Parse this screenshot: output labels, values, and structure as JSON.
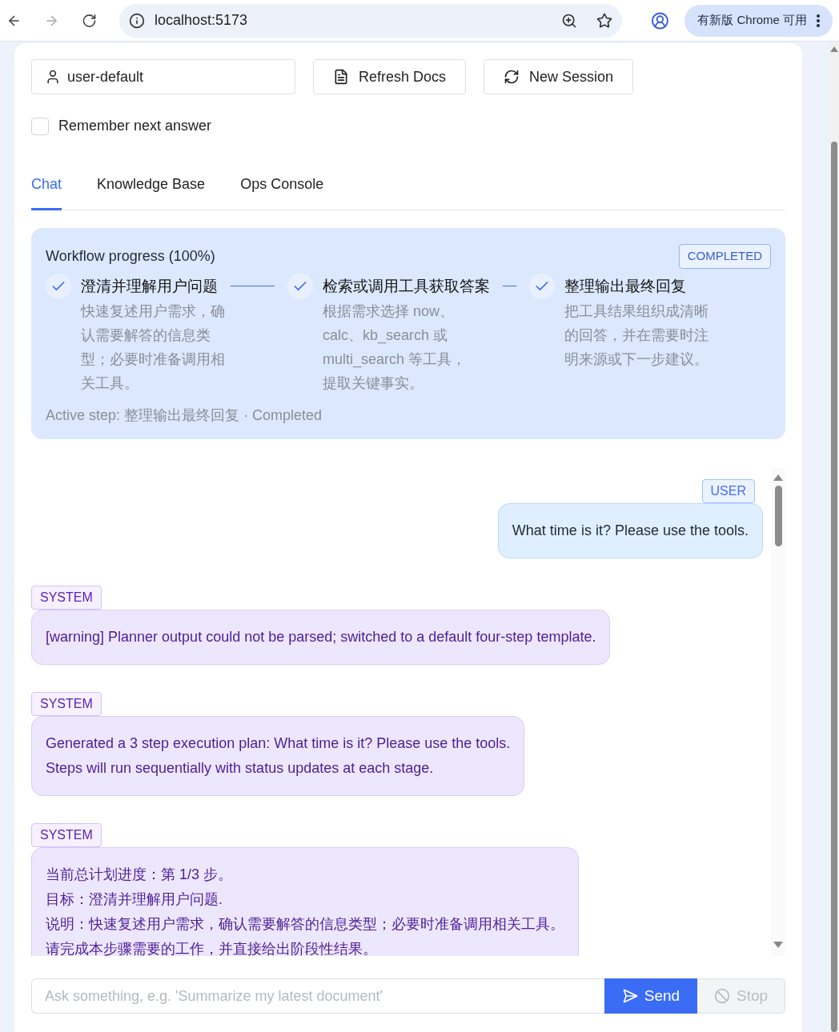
{
  "browser": {
    "url": "localhost:5173",
    "update_button": "有新版 Chrome 可用"
  },
  "toolbar": {
    "user_field": "user-default",
    "buttons": [
      "Refresh Docs",
      "New Session"
    ]
  },
  "remember": {
    "label": "Remember next answer",
    "checked": false
  },
  "tabs": [
    {
      "label": "Chat",
      "selected": true
    },
    {
      "label": "Knowledge Base",
      "selected": false
    },
    {
      "label": "Ops Console",
      "selected": false
    }
  ],
  "workflow": {
    "title": "Workflow progress (100%)",
    "status": "COMPLETED",
    "steps": [
      {
        "title": "澄清并理解用户问题",
        "description": "快速复述用户需求，确认需要解答的信息类型；必要时准备调用相关工具。",
        "done": true
      },
      {
        "title": "检索或调用工具获取答案",
        "description": "根据需求选择 now、calc、kb_search 或 multi_search 等工具，提取关键事实。",
        "done": true
      },
      {
        "title": "整理输出最终回复",
        "description": "把工具结果组织成清晰的回答，并在需要时注明来源或下一步建议。",
        "done": true
      }
    ],
    "active_step": "Active step: 整理输出最终回复 · Completed"
  },
  "messages": [
    {
      "kind": "user",
      "badge": "USER",
      "lines": [
        "What time is it? Please use the tools."
      ]
    },
    {
      "kind": "system",
      "badge": "SYSTEM",
      "lines": [
        "[warning] Planner output could not be parsed; switched to a default four-step template."
      ]
    },
    {
      "kind": "system",
      "badge": "SYSTEM",
      "lines": [
        "Generated a 3 step execution plan: What time is it? Please use the tools.",
        "Steps will run sequentially with status updates at each stage."
      ]
    },
    {
      "kind": "system",
      "badge": "SYSTEM",
      "lines": [
        "当前总计划进度：第 1/3 步。",
        "目标：澄清并理解用户问题.",
        "说明：快速复述用户需求，确认需要解答的信息类型；必要时准备调用相关工具。",
        "请完成本步骤需要的工作，并直接给出阶段性结果。"
      ]
    }
  ],
  "composer": {
    "placeholder": "Ask something, e.g. 'Summarize my latest document'",
    "send": "Send",
    "stop": "Stop",
    "stop_disabled": true
  }
}
